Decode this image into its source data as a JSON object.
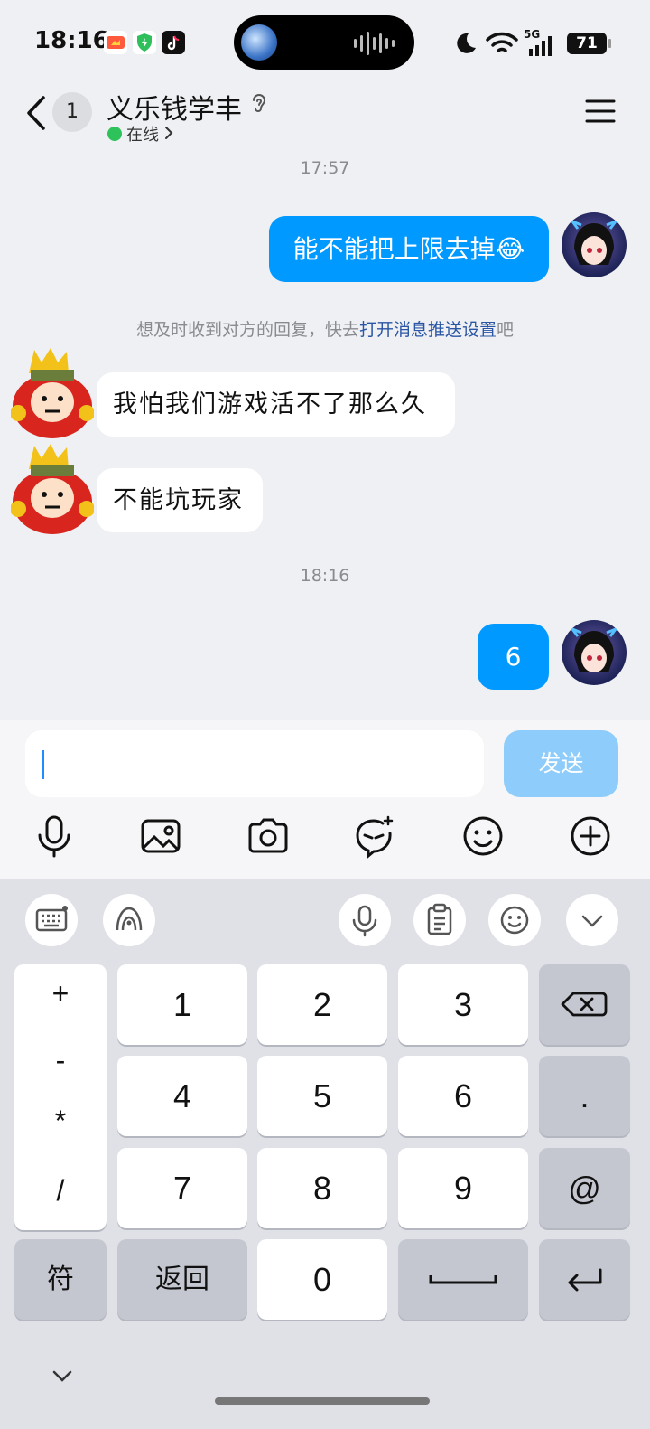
{
  "status_bar": {
    "time": "18:16",
    "battery": "71",
    "network": "5G"
  },
  "header": {
    "unread_count": "1",
    "contact_name": "义乐钱学丰",
    "status": "在线"
  },
  "messages": {
    "time1": "17:57",
    "msg1": "能不能把上限去掉😂",
    "notice_pre": "想及时收到对方的回复，快去",
    "notice_link": "打开消息推送设置",
    "notice_post": "吧",
    "msg2": "我怕我们游戏活不了那么久",
    "msg3": "不能坑玩家",
    "time2": "18:16",
    "msg4": "6"
  },
  "input": {
    "value": "",
    "send_label": "发送"
  },
  "toolbar": {
    "icons": [
      "mic-icon",
      "image-icon",
      "camera-icon",
      "sticker-icon",
      "emoji-icon",
      "plus-icon"
    ]
  },
  "keyboard": {
    "side_symbols": [
      "+",
      "-",
      "*",
      "/"
    ],
    "row1": [
      "1",
      "2",
      "3"
    ],
    "row2": [
      "4",
      "5",
      "6",
      "."
    ],
    "row3": [
      "7",
      "8",
      "9",
      "@"
    ],
    "symbols_key": "符",
    "back_key": "返回",
    "zero_key": "0"
  },
  "colors": {
    "accent": "#0099ff",
    "send_disabled": "#8dccfb",
    "online": "#2ec25b",
    "link": "#2a56a5"
  }
}
